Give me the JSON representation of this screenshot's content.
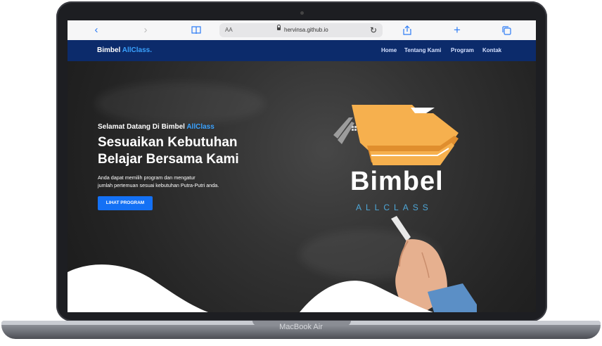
{
  "device": {
    "model_label": "MacBook Air"
  },
  "browser": {
    "back_icon": "chevron-left-icon",
    "forward_icon": "chevron-right-icon",
    "bookmarks_icon": "book-icon",
    "text_size_label": "AA",
    "url": "hervinsa.github.io",
    "reload_icon": "reload-icon",
    "share_icon": "share-icon",
    "new_tab_icon": "plus-icon",
    "tabs_icon": "tabs-icon"
  },
  "site": {
    "brand": {
      "name": "Bimbel ",
      "accent": "AllClass."
    },
    "nav": [
      "Home",
      "Tentang Kami",
      "Program",
      "Kontak"
    ],
    "hero": {
      "welcome_prefix": "Selamat Datang Di Bimbel ",
      "welcome_accent": "AllClass",
      "headline_line1": "Sesuaikan Kebutuhan",
      "headline_line2": "Belajar Bersama Kami",
      "description_line1": "Anda dapat memilih program dan mengatur",
      "description_line2": "jumlah pertemuan sesuai kebutuhan Putra-Putri anda.",
      "cta_label": "LIHAT PROGRAM"
    },
    "logo": {
      "word": "Bimbel",
      "sub": "ALLCLASS"
    }
  },
  "colors": {
    "nav_bg": "#0c2b6b",
    "accent_blue": "#3aa2ff",
    "cta_blue": "#1471f5",
    "logo_orange": "#f6b04e"
  }
}
